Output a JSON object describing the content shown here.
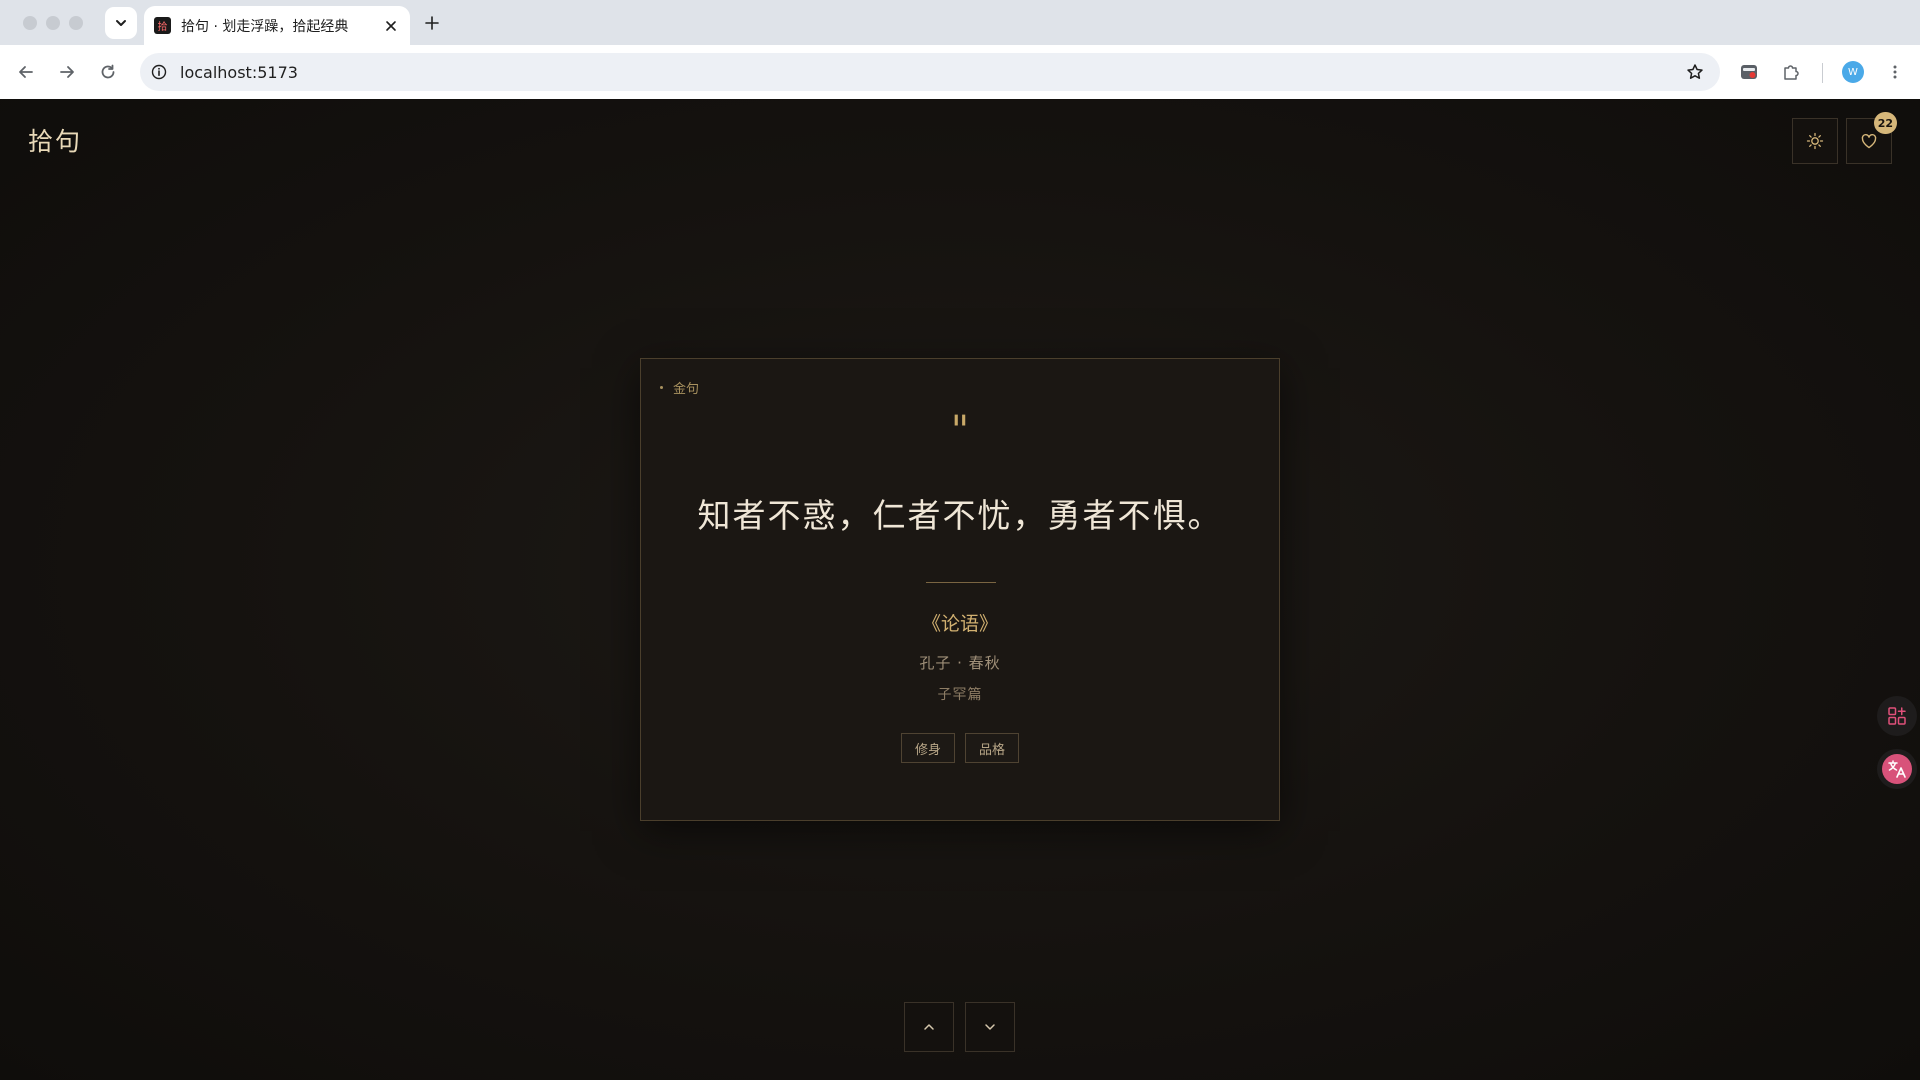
{
  "browser": {
    "tab_title": "拾句 · 划走浮躁，拾起经典",
    "favicon_text": "拾",
    "url": "localhost:5173",
    "profile_initial": "W"
  },
  "app": {
    "logo": "拾句",
    "favorites_count": "22"
  },
  "card": {
    "tag_label": "金句",
    "quote_mark": "\"",
    "quote": "知者不惑，仁者不忧，勇者不惧。",
    "source": "《论语》",
    "author": "孔子 · 春秋",
    "chapter": "子罕篇",
    "tags": [
      "修身",
      "品格"
    ]
  },
  "colors": {
    "background": "#15120f",
    "card_bg": "#1b1713",
    "accent_gold": "#d2b171",
    "text_light": "#efe6d6"
  },
  "icons": {
    "theme_toggle": "sun-icon",
    "favorites": "heart-icon",
    "prev": "chevron-up-icon",
    "next": "chevron-down-icon"
  }
}
